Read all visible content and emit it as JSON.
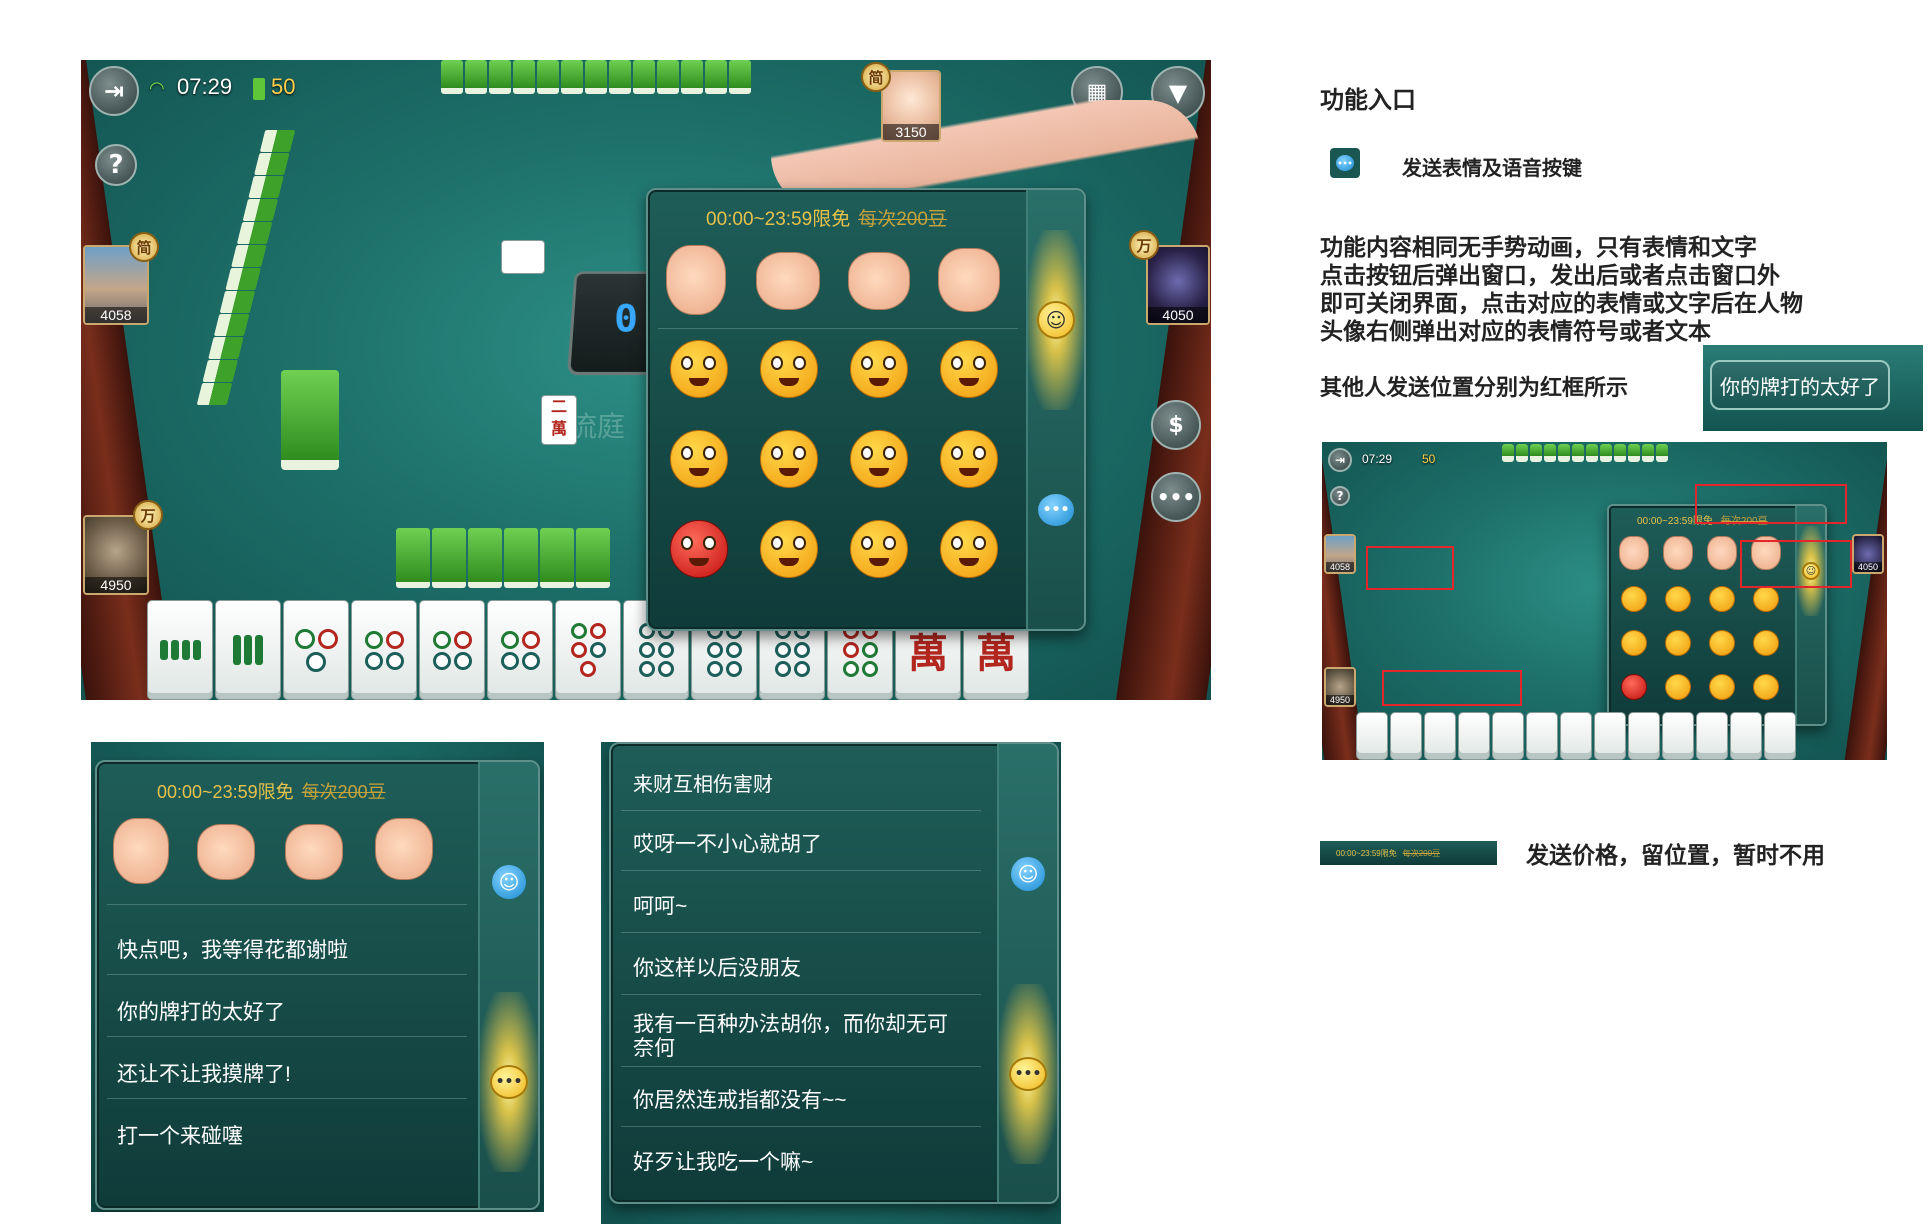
{
  "main_screenshot": {
    "status": {
      "time": "07:29",
      "beans": "50"
    },
    "center_tile_label": "二\n萬",
    "center_text": "汉流庭",
    "players": {
      "top": {
        "score": "3150",
        "badge": "简"
      },
      "left": {
        "score": "4058",
        "badge": "简"
      },
      "bottom_left": {
        "score": "4950",
        "badge": "万"
      },
      "right": {
        "score": "4050",
        "badge": "万"
      }
    },
    "timer_digit": "0",
    "emote_panel": {
      "price_text": "00:00~23:59限免",
      "price_strike": "每次200豆"
    }
  },
  "text_panel_left": {
    "price_text": "00:00~23:59限免",
    "price_strike": "每次200豆",
    "phrases": [
      "快点吧，我等得花都谢啦",
      "你的牌打的太好了",
      "还让不让我摸牌了!",
      "打一个来碰噻"
    ]
  },
  "text_panel_right": {
    "partial_top": "来财互相伤害财",
    "phrases": [
      "哎呀一不小心就胡了",
      "呵呵~",
      "你这样以后没朋友",
      "我有一百种办法胡你，而你却无可",
      "奈何",
      "你居然连戒指都没有~~",
      "好歹让我吃一个嘛~"
    ]
  },
  "notes": {
    "title": "功能入口",
    "entry_label": "发送表情及语音按键",
    "desc_lines": [
      "功能内容相同无手势动画，只有表情和文字",
      "点击按钮后弹出窗口，发出后或者点击窗口外",
      "即可关闭界面，点击对应的表情或文字后在人物",
      "头像右侧弹出对应的表情符号或者文本"
    ],
    "other_send": "其他人发送位置分别为红框所示",
    "bubble_text": "你的牌打的太好了",
    "price_note": "发送价格，留位置，暂时不用"
  },
  "mini_screenshot": {
    "time": "07:29",
    "beans": "50",
    "price_text": "00:00~23:59限免",
    "price_strike": "每次200豆",
    "scores": [
      "4058",
      "4950",
      "4050"
    ]
  },
  "mini_price_bar": {
    "price_text": "00:00~23:59限免",
    "price_strike": "每次200豆"
  },
  "colors": {
    "felt": "#1d6f69",
    "panel": "#1f5d58",
    "price": "#e6c24a",
    "red_box": "#e3262b"
  }
}
